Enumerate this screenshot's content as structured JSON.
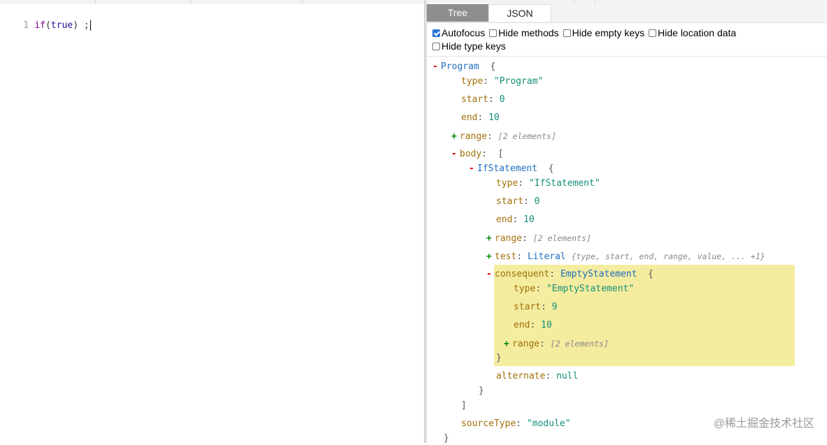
{
  "editor": {
    "line_number": "1",
    "code": {
      "kw": "if",
      "open": "(",
      "atom": "true",
      "close": ")",
      "rest": " ;"
    }
  },
  "panel": {
    "tabs": [
      {
        "label": "Tree",
        "active": true
      },
      {
        "label": "JSON",
        "active": false
      }
    ],
    "options": [
      {
        "label": "Autofocus",
        "checked": true
      },
      {
        "label": "Hide methods",
        "checked": false
      },
      {
        "label": "Hide empty keys",
        "checked": false
      },
      {
        "label": "Hide location data",
        "checked": false
      },
      {
        "label": "Hide type keys",
        "checked": false
      }
    ]
  },
  "tree": {
    "program_label": "Program",
    "program_type_key": "type",
    "program_type_val": "\"Program\"",
    "start_key": "start",
    "program_start_val": "0",
    "end_key": "end",
    "program_end_val": "10",
    "range_key": "range",
    "range_summary": "[2 elements]",
    "body_key": "body",
    "if_label": "IfStatement",
    "if_type_val": "\"IfStatement\"",
    "if_start_val": "0",
    "if_end_val": "10",
    "test_key": "test",
    "test_node": "Literal",
    "test_summary": "{type, start, end, range, value, ... +1}",
    "consequent_key": "consequent",
    "consequent_node": "EmptyStatement",
    "empty_type_val": "\"EmptyStatement\"",
    "empty_start_val": "9",
    "empty_end_val": "10",
    "alternate_key": "alternate",
    "alternate_val": "null",
    "sourcetype_key": "sourceType",
    "sourcetype_val": "\"module\"",
    "open_brace": "{",
    "close_brace": "}",
    "open_bracket": "[",
    "close_bracket": "]",
    "colon": ":",
    "minus": "-",
    "plus": "+"
  },
  "watermark": "@稀土掘金技术社区",
  "colors": {
    "tab_active": "#8e8e8e",
    "highlight": "#f4ec9f",
    "node": "#1f6fbf",
    "key": "#a0700a",
    "value": "#14907a"
  }
}
